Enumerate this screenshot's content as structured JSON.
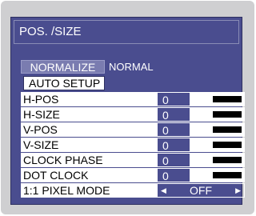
{
  "menu": {
    "title": "POS. /SIZE",
    "normalize_button": "NORMALIZE",
    "normalize_status": "NORMAL",
    "auto_setup_button": "AUTO SETUP",
    "rows": [
      {
        "label": "H-POS",
        "value": "0"
      },
      {
        "label": "H-SIZE",
        "value": "0"
      },
      {
        "label": "V-POS",
        "value": "0"
      },
      {
        "label": "V-SIZE",
        "value": "0"
      },
      {
        "label": "CLOCK PHASE",
        "value": "0"
      },
      {
        "label": "DOT CLOCK",
        "value": "0"
      }
    ],
    "pixel_mode": {
      "label": "1:1 PIXEL MODE",
      "value": "OFF"
    }
  },
  "colors": {
    "panel": "#4a4d8f",
    "frame": "#cfcfd1",
    "highlight": "#7a7cb0"
  }
}
